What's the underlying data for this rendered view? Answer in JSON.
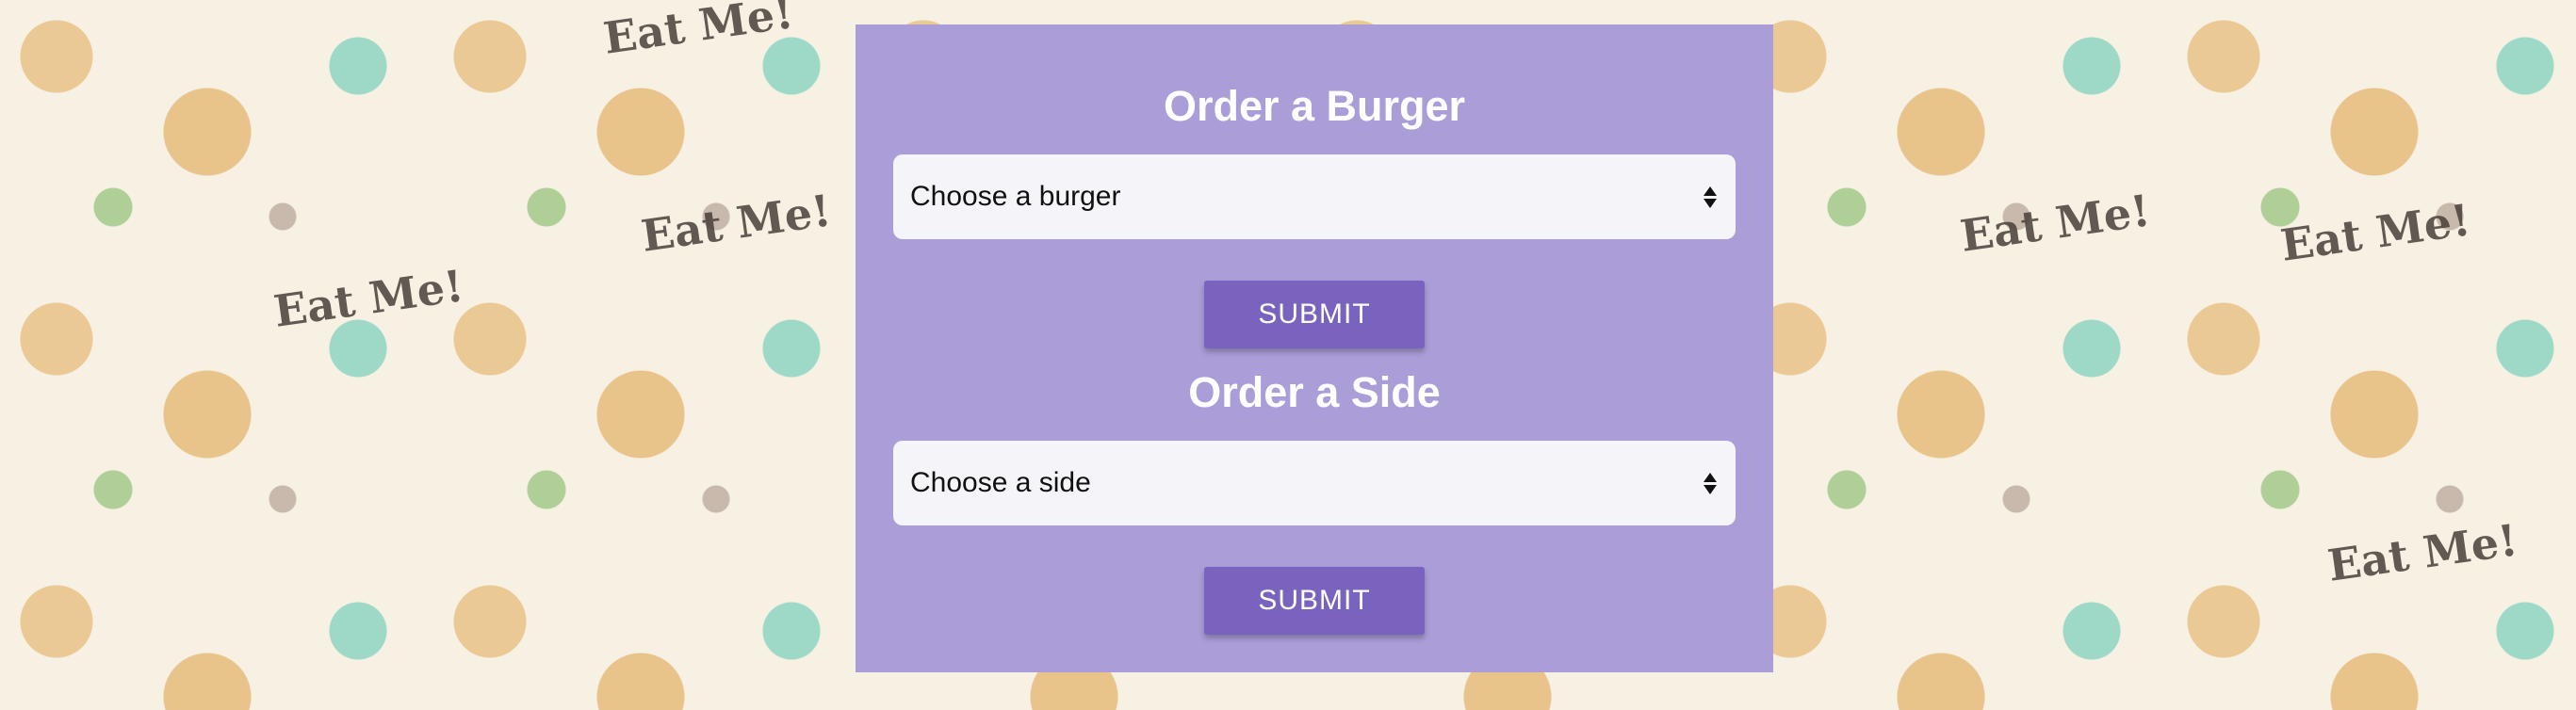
{
  "colors": {
    "panel": "#ab9dd7",
    "button": "#7a62bf",
    "select_bg": "#f5f4f9",
    "text_white": "#ffffff"
  },
  "background": {
    "words": [
      "Eat Me!",
      "Eat Me!",
      "Eat Me!",
      "Eat Me!",
      "Eat Me!",
      "Eat Me!"
    ]
  },
  "burger_form": {
    "title": "Order a Burger",
    "select_value": "Choose a burger",
    "submit_label": "SUBMIT",
    "select_icon": "up-down-arrows-icon"
  },
  "side_form": {
    "title": "Order a Side",
    "select_value": "Choose a side",
    "submit_label": "SUBMIT",
    "select_icon": "up-down-arrows-icon"
  }
}
